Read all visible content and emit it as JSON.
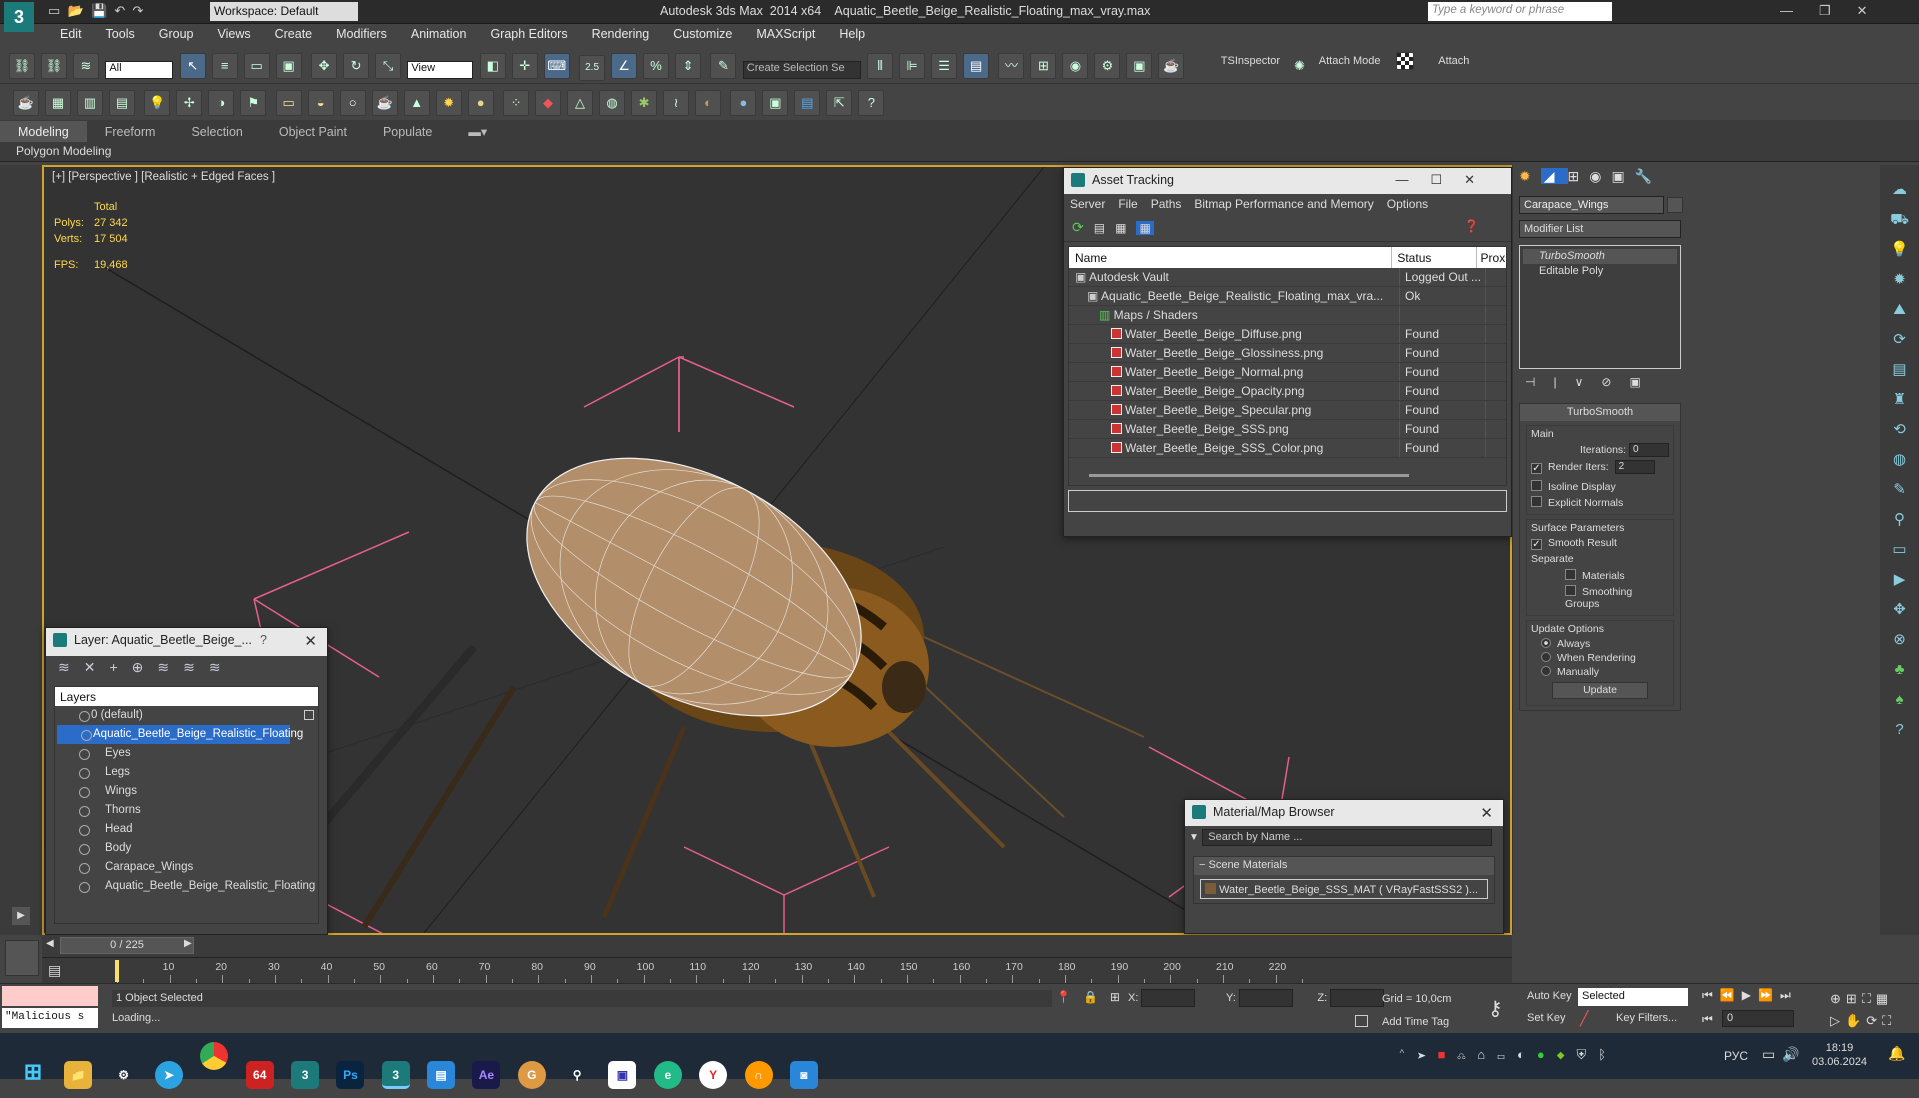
{
  "titlebar": {
    "workspace": "Workspace: Default",
    "app_title": "Autodesk 3ds Max  2014 x64    Aquatic_Beetle_Beige_Realistic_Floating_max_vray.max",
    "search_placeholder": "Type a keyword or phrase"
  },
  "menu": [
    "Edit",
    "Tools",
    "Group",
    "Views",
    "Create",
    "Modifiers",
    "Animation",
    "Graph Editors",
    "Rendering",
    "Customize",
    "MAXScript",
    "Help"
  ],
  "toolbar": {
    "selection_filter": "All",
    "ref_coord": "View",
    "named_selection": "Create Selection Se",
    "snap_value": "2.5",
    "tsinspector": "TSInspector",
    "attach_mode": "Attach Mode",
    "attach": "Attach"
  },
  "ribbon": {
    "tabs": [
      "Modeling",
      "Freeform",
      "Selection",
      "Object Paint",
      "Populate"
    ],
    "panel_label": "Polygon Modeling"
  },
  "viewport": {
    "label": "[+] [Perspective ] [Realistic + Edged Faces ]",
    "stats_header": "Total",
    "polys_label": "Polys:",
    "polys_value": "27 342",
    "verts_label": "Verts:",
    "verts_value": "17 504",
    "fps_label": "FPS:",
    "fps_value": "19,468"
  },
  "asset_tracking": {
    "title": "Asset Tracking",
    "menu": [
      "Server",
      "File",
      "Paths",
      "Bitmap Performance and Memory",
      "Options"
    ],
    "columns": [
      "Name",
      "Status",
      "Prox"
    ],
    "rows": [
      {
        "name": "Autodesk Vault",
        "status": "Logged Out ...",
        "indent": 0
      },
      {
        "name": "Aquatic_Beetle_Beige_Realistic_Floating_max_vra...",
        "status": "Ok",
        "indent": 1
      },
      {
        "name": "Maps / Shaders",
        "status": "",
        "indent": 2
      },
      {
        "name": "Water_Beetle_Beige_Diffuse.png",
        "status": "Found",
        "indent": 3
      },
      {
        "name": "Water_Beetle_Beige_Glossiness.png",
        "status": "Found",
        "indent": 3
      },
      {
        "name": "Water_Beetle_Beige_Normal.png",
        "status": "Found",
        "indent": 3
      },
      {
        "name": "Water_Beetle_Beige_Opacity.png",
        "status": "Found",
        "indent": 3
      },
      {
        "name": "Water_Beetle_Beige_Specular.png",
        "status": "Found",
        "indent": 3
      },
      {
        "name": "Water_Beetle_Beige_SSS.png",
        "status": "Found",
        "indent": 3
      },
      {
        "name": "Water_Beetle_Beige_SSS_Color.png",
        "status": "Found",
        "indent": 3
      }
    ]
  },
  "layer_window": {
    "title": "Layer: Aquatic_Beetle_Beige_...",
    "header": "Layers",
    "default_layer": "0 (default)",
    "active_layer": "Aquatic_Beetle_Beige_Realistic_Floating",
    "children": [
      "Eyes",
      "Legs",
      "Wings",
      "Thorns",
      "Head",
      "Body",
      "Carapace_Wings",
      "Aquatic_Beetle_Beige_Realistic_Floating"
    ]
  },
  "material_browser": {
    "title": "Material/Map Browser",
    "search_placeholder": "Search by Name ...",
    "section": "Scene Materials",
    "material": "Water_Beetle_Beige_SSS_MAT  ( VRayFastSSS2 )..."
  },
  "command_panel": {
    "object_name": "Carapace_Wings",
    "modifier_list": "Modifier List",
    "stack": [
      "TurboSmooth",
      "Editable Poly"
    ],
    "rollout_title": "TurboSmooth",
    "main_label": "Main",
    "iterations_label": "Iterations:",
    "iterations_value": "0",
    "render_iters_label": "Render Iters:",
    "render_iters_value": "2",
    "isoline": "Isoline Display",
    "explicit_normals": "Explicit Normals",
    "surface_params": "Surface Parameters",
    "smooth_result": "Smooth Result",
    "separate": "Separate",
    "materials": "Materials",
    "smoothing_groups": "Smoothing Groups",
    "update_options": "Update Options",
    "always": "Always",
    "when_rendering": "When Rendering",
    "manually": "Manually",
    "update_btn": "Update"
  },
  "timeline": {
    "frame": "0 / 225",
    "ticks": [
      "10",
      "20",
      "30",
      "40",
      "50",
      "60",
      "70",
      "80",
      "90",
      "100",
      "110",
      "120",
      "130",
      "140",
      "150",
      "160",
      "170",
      "180",
      "190",
      "200",
      "210",
      "220"
    ]
  },
  "status": {
    "script": "\"Malicious s",
    "selected": "1 Object Selected",
    "loading": "Loading...",
    "x_label": "X:",
    "y_label": "Y:",
    "z_label": "Z:",
    "grid": "Grid = 10,0cm",
    "add_time_tag": "Add Time Tag",
    "auto_key": "Auto Key",
    "set_key": "Set Key",
    "key_mode": "Selected",
    "key_filters": "Key Filters...",
    "frame_value": "0"
  },
  "taskbar": {
    "lang": "РУС",
    "time": "18:19",
    "date": "03.06.2024",
    "badge": "64"
  },
  "colors": {
    "accent": "#d2a32a",
    "selection": "#2a6cc8",
    "stats_yellow": "#ffd84a"
  }
}
